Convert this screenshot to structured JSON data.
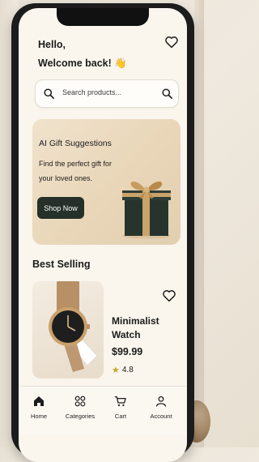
{
  "header": {
    "greeting_line1": "Hello,",
    "greeting_line2": "Welcome back! 👋"
  },
  "search": {
    "placeholder": "Search products..."
  },
  "promo": {
    "title": "AI Gift Suggestions",
    "subtitle": "Find the perfect gift for your loved ones.",
    "button_label": "Shop Now"
  },
  "best_selling": {
    "title": "Best Selling",
    "product": {
      "name": "Minimalist Watch",
      "price": "$99.99",
      "rating": "4.8"
    }
  },
  "tabbar": {
    "items": [
      {
        "label": "Home",
        "icon": "home-icon"
      },
      {
        "label": "Categories",
        "icon": "grid-icon"
      },
      {
        "label": "Cart",
        "icon": "cart-icon"
      },
      {
        "label": "Account",
        "icon": "user-icon"
      }
    ]
  },
  "colors": {
    "background": "#faf5ed",
    "accent_dark": "#243029",
    "promo_bg": "#ecdcc2",
    "star": "#c9a227"
  }
}
